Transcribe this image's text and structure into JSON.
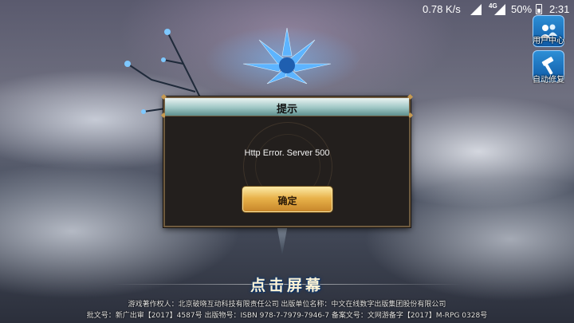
{
  "status_bar": {
    "speed": "0.78 K/s",
    "network": "4G",
    "battery": "50%",
    "time": "2:31"
  },
  "side_buttons": [
    {
      "label": "用户中心",
      "icon": "user-center-icon"
    },
    {
      "label": "自动修复",
      "icon": "hammer-icon"
    }
  ],
  "dialog": {
    "title": "提示",
    "message": "Http Error. Server 500",
    "ok_label": "确定"
  },
  "tap_to_start": "点击屏幕",
  "footer": {
    "line1": "游戏著作权人：北京破晓互动科技有限责任公司   出版单位名称：中文在线数字出版集团股份有限公司",
    "line2": "批文号：新广出审【2017】4587号    出版物号：ISBN  978-7-7979-7946-7    备案文号：文网游备字【2017】M-RPG  0328号"
  }
}
